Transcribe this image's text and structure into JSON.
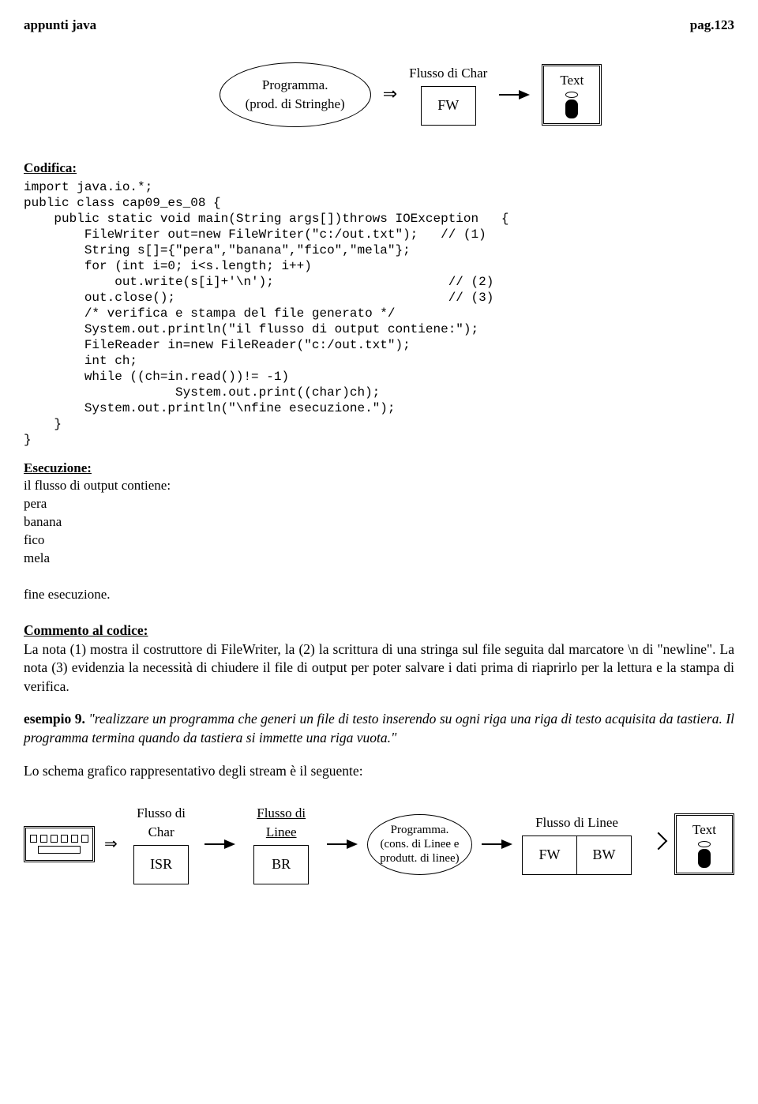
{
  "header": {
    "left": "appunti java",
    "right": "pag.123"
  },
  "diagram1": {
    "ellipse_line1": "Programma.",
    "ellipse_line2": "(prod. di Stringhe)",
    "flow_label": "Flusso di Char",
    "box_fw": "FW",
    "text_label": "Text"
  },
  "sections": {
    "codifica": "Codifica:",
    "esecuzione": "Esecuzione:",
    "commento": "Commento al codice:",
    "esempio9": "esempio 9."
  },
  "code": "import java.io.*;\npublic class cap09_es_08 {\n    public static void main(String args[])throws IOException   {\n        FileWriter out=new FileWriter(\"c:/out.txt\");   // (1)\n        String s[]={\"pera\",\"banana\",\"fico\",\"mela\"};\n        for (int i=0; i<s.length; i++)\n            out.write(s[i]+'\\n');                       // (2)\n        out.close();                                    // (3)\n        /* verifica e stampa del file generato */\n        System.out.println(\"il flusso di output contiene:\");\n        FileReader in=new FileReader(\"c:/out.txt\");\n        int ch;\n        while ((ch=in.read())!= -1)\n                    System.out.print((char)ch);\n        System.out.println(\"\\nfine esecuzione.\");\n    }\n}",
  "exec": {
    "line1": "il flusso di output contiene:",
    "line2": "pera",
    "line3": "banana",
    "line4": "fico",
    "line5": "mela",
    "line6": "fine esecuzione."
  },
  "commento_text": "La nota (1) mostra il costruttore di FileWriter, la (2) la scrittura di una stringa sul file seguita dal marcatore \\n di \"newline\". La nota (3) evidenzia la necessità di chiudere il file di output per poter salvare i dati prima di riaprirlo per la lettura e la stampa di verifica.",
  "esempio9_text": " \"realizzare un programma che generi un file di testo inserendo su ogni riga una riga di testo acquisita da tastiera. Il programma termina quando da tastiera si immette una riga vuota.\"",
  "schema_intro": "Lo schema grafico rappresentativo degli stream è il seguente:",
  "diagram2": {
    "label1": "Flusso di Char",
    "label2": "Flusso di Linee",
    "label3": "Flusso di Linee",
    "box_isr": "ISR",
    "box_br": "BR",
    "ellipse_line1": "Programma.",
    "ellipse_line2": "(cons. di Linee e",
    "ellipse_line3": "produtt. di linee)",
    "box_fw": "FW",
    "box_bw": "BW",
    "text_label": "Text"
  }
}
